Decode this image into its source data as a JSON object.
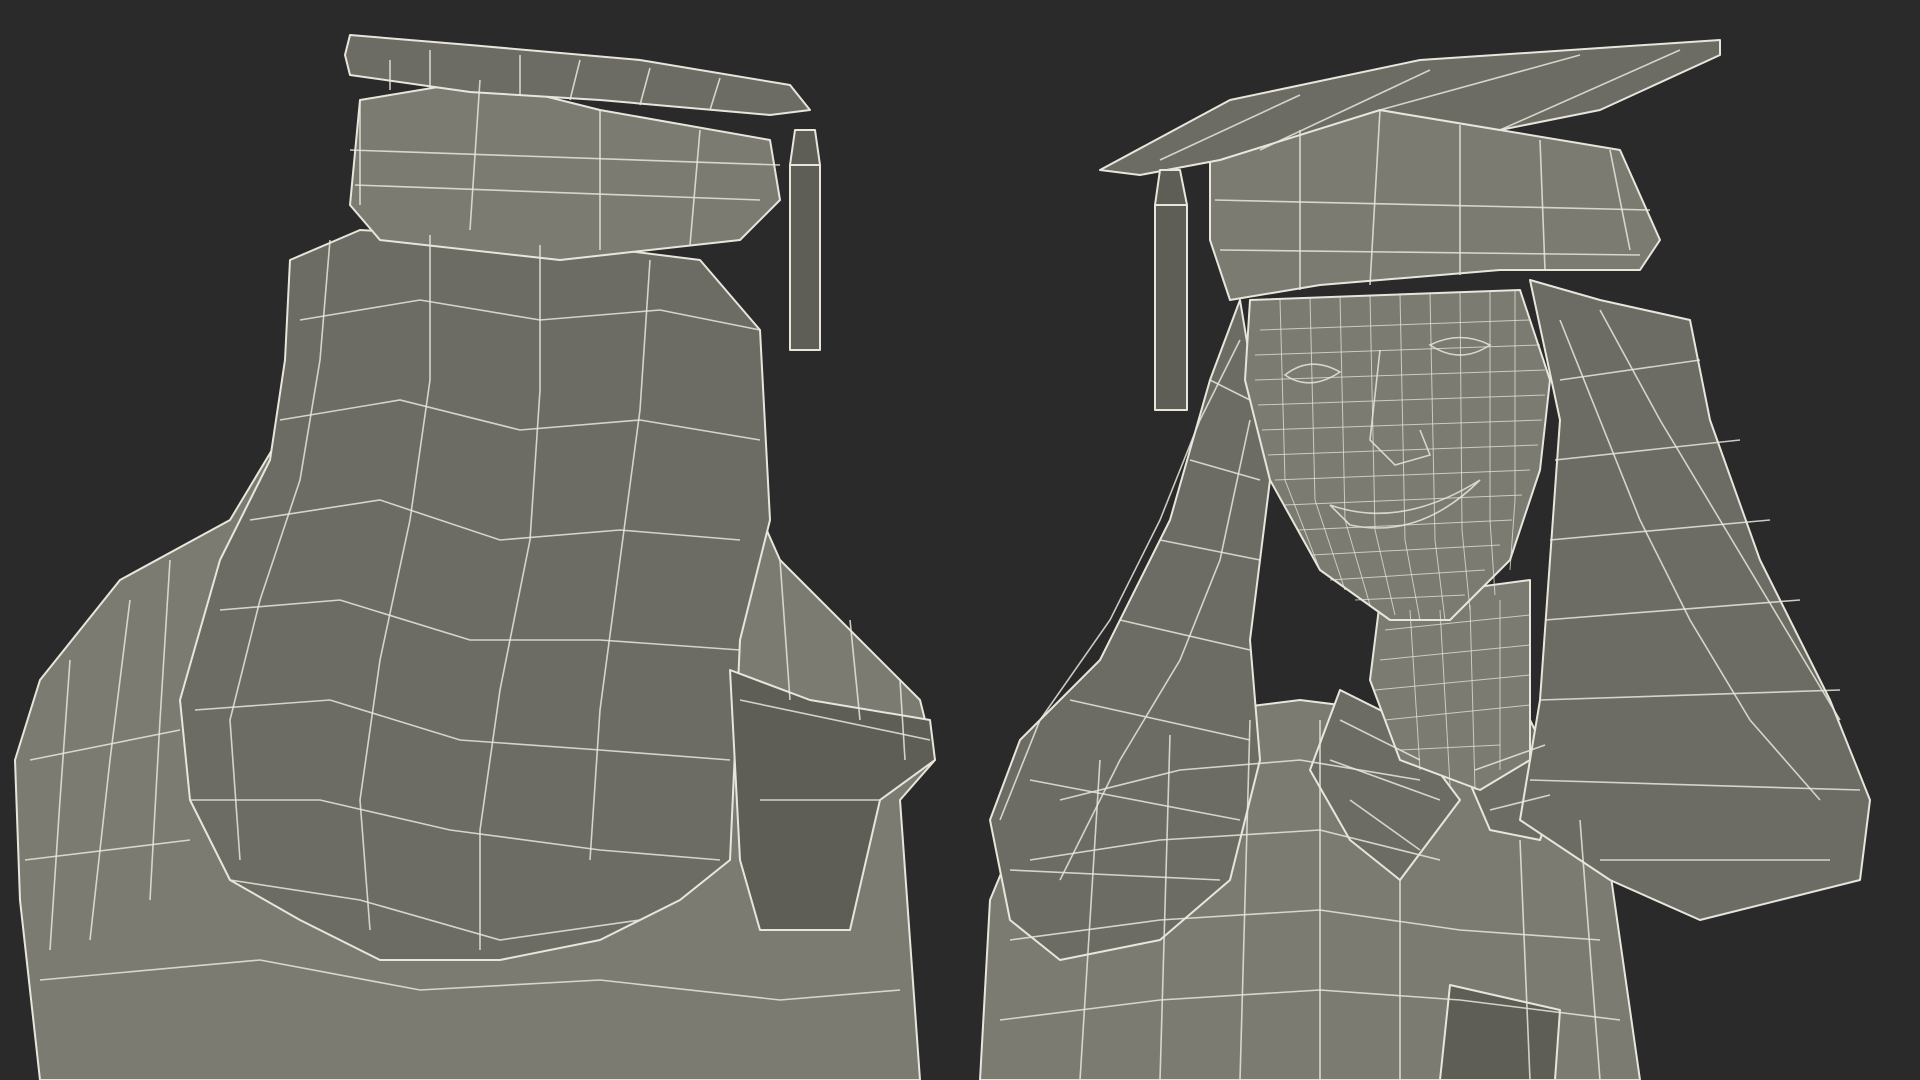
{
  "colors": {
    "background": "#2a2a2a",
    "surface": "#7b7b72",
    "wireframe": "#e8e6dc"
  },
  "figures": [
    {
      "view": "back"
    },
    {
      "view": "front"
    }
  ]
}
